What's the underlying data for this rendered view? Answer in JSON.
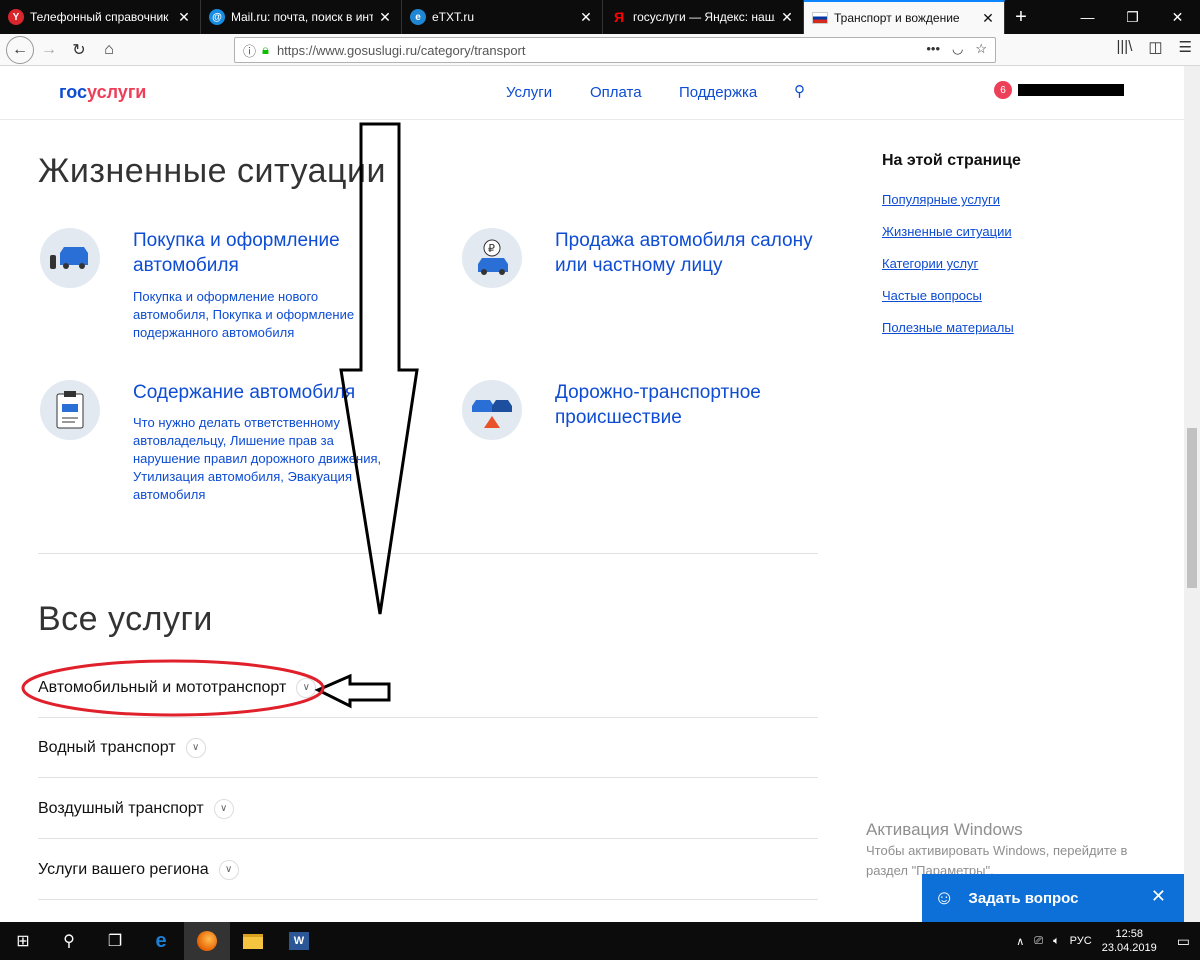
{
  "browser": {
    "tabs": [
      {
        "title": "Телефонный справочник",
        "icon": "Y",
        "icon_color": "#d8262c"
      },
      {
        "title": "Mail.ru: почта, поиск в инте",
        "icon": "@",
        "icon_color": "#168de2"
      },
      {
        "title": "eTXT.ru",
        "icon": "e",
        "icon_color": "#1f86d3"
      },
      {
        "title": "госуслуги — Яндекс: нашлс",
        "icon": "Я",
        "icon_color": "#f00"
      },
      {
        "title": "Транспорт и вождение",
        "icon": "flag",
        "icon_color": "#0039a6",
        "active": true
      }
    ],
    "url": "https://www.gosuslugi.ru/category/transport"
  },
  "header": {
    "logo_part1": "гос",
    "logo_part2": "услуги",
    "nav": [
      "Услуги",
      "Оплата",
      "Поддержка"
    ],
    "notifications": "6"
  },
  "life": {
    "heading": "Жизненные ситуации",
    "cards": [
      {
        "title": "Покупка и оформление автомобиля",
        "desc": "Покупка и оформление нового автомобиля, Покупка и оформление подержанного автомобиля"
      },
      {
        "title": "Продажа автомобиля салону или частному лицу",
        "desc": ""
      },
      {
        "title": "Содержание автомобиля",
        "desc": "Что нужно делать ответственному автовладельцу, Лишение прав за нарушение правил дорожного движения, Утилизация автомобиля, Эвакуация автомобиля"
      },
      {
        "title": "Дорожно-транспортное происшествие",
        "desc": ""
      }
    ]
  },
  "services": {
    "heading": "Все услуги",
    "items": [
      "Автомобильный и мототранспорт",
      "Водный транспорт",
      "Воздушный транспорт",
      "Услуги вашего региона"
    ]
  },
  "onpage": {
    "heading": "На этой странице",
    "links": [
      "Популярные услуги",
      "Жизненные ситуации",
      "Категории услуг",
      "Частые вопросы",
      "Полезные материалы"
    ]
  },
  "watermark": {
    "title": "Активация Windows",
    "text1": "Чтобы активировать Windows, перейдите в",
    "text2": "раздел \"Параметры\"."
  },
  "ask": {
    "label": "Задать вопрос"
  },
  "taskbar": {
    "lang": "РУС",
    "time": "12:58",
    "date": "23.04.2019"
  }
}
